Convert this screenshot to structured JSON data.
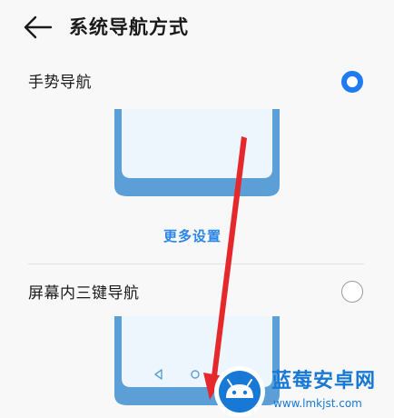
{
  "header": {
    "back_icon": "arrow-left-icon",
    "title": "系统导航方式"
  },
  "options": [
    {
      "label": "手势导航",
      "selected": true
    },
    {
      "label": "屏幕内三键导航",
      "selected": false
    }
  ],
  "gesture": {
    "more_settings_link": "更多设置"
  },
  "colors": {
    "accent": "#1f7bf0",
    "link": "#2a86e8",
    "phone_frame": "#5b9fd6",
    "phone_screen": "#eef6fd",
    "arrow": "#e5282c",
    "watermark": "#1778d6"
  },
  "watermark": {
    "name": "蓝莓安卓网",
    "url": "www.lmkjst.com",
    "icon": "android-robot-icon"
  }
}
